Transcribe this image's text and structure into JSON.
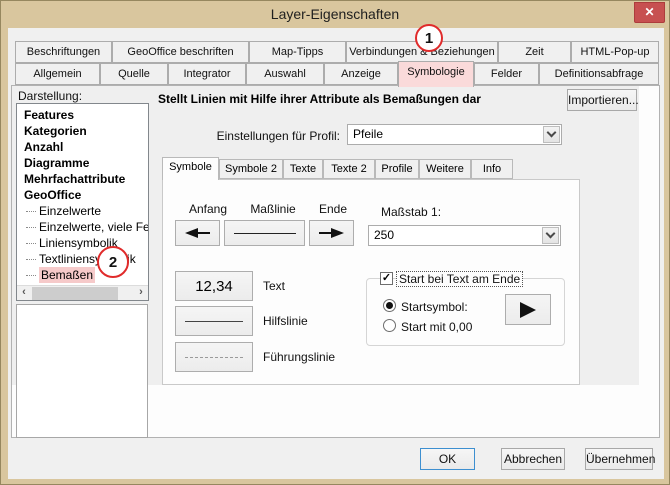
{
  "window": {
    "title": "Layer-Eigenschaften"
  },
  "glyphs": {
    "close": "✕",
    "check": "✓",
    "scroll_left": "‹",
    "scroll_right": "›"
  },
  "tabs_row1": [
    "Beschriftungen",
    "GeoOffice beschriften",
    "Map-Tipps",
    "Verbindungen & Beziehungen",
    "Zeit",
    "HTML-Pop-up"
  ],
  "tabs_row2": [
    "Allgemein",
    "Quelle",
    "Integrator",
    "Auswahl",
    "Anzeige",
    "Symbologie",
    "Felder",
    "Definitionsabfrage"
  ],
  "selected_tab": "Symbologie",
  "sidebar": {
    "label": "Darstellung:",
    "bold_items": [
      "Features",
      "Kategorien",
      "Anzahl",
      "Diagramme",
      "Mehrfachattribute",
      "GeoOffice"
    ],
    "sub_items": [
      "Einzelwerte",
      "Einzelwerte, viele Felder",
      "Liniensymbolik",
      "Textliniensymbolik",
      "Bemaßen"
    ],
    "selected_sub_item": "Bemaßen"
  },
  "main": {
    "description": "Stellt Linien mit Hilfe ihrer Attribute als Bemaßungen dar",
    "import_button": "Importieren...",
    "profile_label": "Einstellungen für Profil:",
    "profile_value": "Pfeile",
    "inner_tabs": [
      "Symbole",
      "Symbole 2",
      "Texte",
      "Texte 2",
      "Profile",
      "Weitere",
      "Info"
    ],
    "selected_inner_tab": "Symbole",
    "symbole": {
      "anfang_label": "Anfang",
      "masslinie_label": "Maßlinie",
      "ende_label": "Ende",
      "massstab_label": "Maßstab 1:",
      "massstab_value": "250",
      "text_button": "12,34",
      "text_label": "Text",
      "hilfslinie_label": "Hilfslinie",
      "fuehrungslinie_label": "Führungslinie",
      "start_group": {
        "checkbox_label": "Start bei Text am Ende",
        "checkbox_checked": true,
        "radio_startsymbol": "Startsymbol:",
        "radio_startmit": "Start mit 0,00",
        "selected_radio": "Startsymbol:"
      }
    }
  },
  "footer": {
    "ok": "OK",
    "cancel": "Abbrechen",
    "apply": "Übernehmen"
  },
  "annotations": {
    "step1": "1",
    "step2": "2"
  },
  "colors": {
    "titlebar": "#d9c69e",
    "close_button": "#c75050",
    "tab_highlight_pink": "#fadada",
    "selection_pink": "#f6caca",
    "annotation_red": "#e02b2b"
  }
}
